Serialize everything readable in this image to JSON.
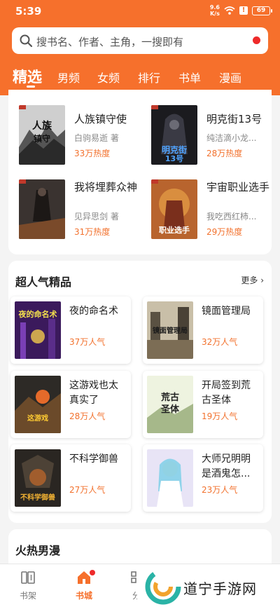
{
  "status": {
    "time": "5:39",
    "net_speed": "9.6",
    "net_unit": "K/s",
    "alert": "!",
    "battery": "69"
  },
  "search": {
    "placeholder": "搜书名、作者、主角，一搜即有"
  },
  "tabs": [
    "精选",
    "男频",
    "女频",
    "排行",
    "书单",
    "漫画"
  ],
  "recommended": [
    {
      "title": "人族镇守使",
      "author": "白驹易逝 著",
      "heat": "33万热度",
      "cover": "ink-mountain"
    },
    {
      "title": "明克街13号",
      "author": "纯洁滴小龙...",
      "heat": "28万热度",
      "cover": "dark-hood"
    },
    {
      "title": "我将埋葬众神",
      "author": "见异思剑 著",
      "heat": "31万热度",
      "cover": "dark-warrior"
    },
    {
      "title": "宇宙职业选手",
      "author": "我吃西红柿...",
      "heat": "29万热度",
      "cover": "red-hero"
    }
  ],
  "popular": {
    "title": "超人气精品",
    "more": "更多",
    "items": [
      {
        "title": "夜的命名术",
        "popularity": "37万人气",
        "cover": "neon-night"
      },
      {
        "title": "镜面管理局",
        "popularity": "32万人气",
        "cover": "city-ruins"
      },
      {
        "title": "这游戏也太真实了",
        "popularity": "28万人气",
        "cover": "fire-game"
      },
      {
        "title": "开局签到荒古圣体",
        "popularity": "19万人气",
        "cover": "sky-sage"
      },
      {
        "title": "不科学御兽",
        "popularity": "27万人气",
        "cover": "beast"
      },
      {
        "title": "大师兄明明是酒鬼怎...",
        "popularity": "23万人气",
        "cover": "anime-girl"
      }
    ]
  },
  "hot_comics": {
    "title": "火热男漫"
  },
  "bottom_nav": [
    {
      "label": "书架",
      "icon": "bookshelf-icon",
      "active": false
    },
    {
      "label": "书城",
      "icon": "store-icon",
      "active": true
    },
    {
      "label": "分",
      "icon": "category-icon",
      "active": false
    }
  ],
  "watermark": {
    "text": "道宁手游网"
  },
  "colors": {
    "accent": "#f6702c",
    "heat": "#f2712d",
    "badge": "#ee2a2a"
  }
}
